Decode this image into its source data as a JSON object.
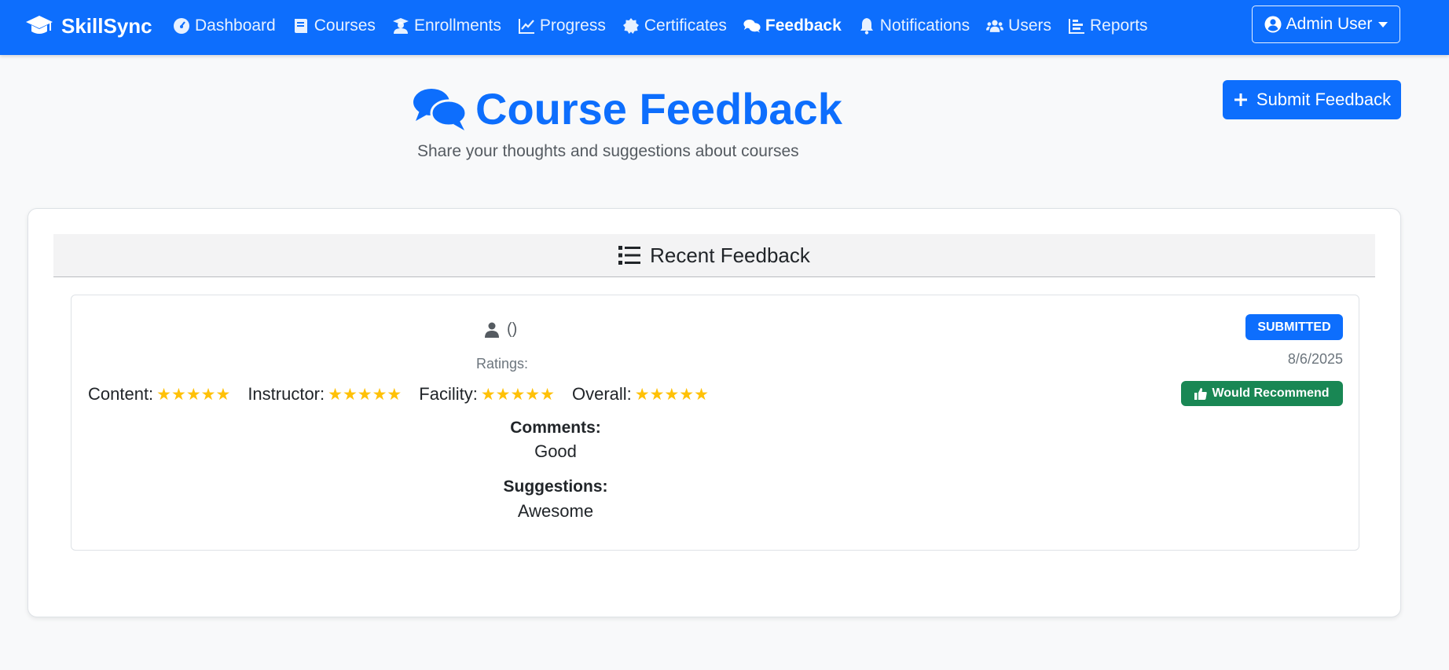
{
  "navbar": {
    "brand": "SkillSync",
    "links": [
      {
        "label": "Dashboard",
        "icon": "dashboard-icon",
        "active": false
      },
      {
        "label": "Courses",
        "icon": "book-icon",
        "active": false
      },
      {
        "label": "Enrollments",
        "icon": "user-graduate-icon",
        "active": false
      },
      {
        "label": "Progress",
        "icon": "chart-line-icon",
        "active": false
      },
      {
        "label": "Certificates",
        "icon": "certificate-icon",
        "active": false
      },
      {
        "label": "Feedback",
        "icon": "comments-icon",
        "active": true
      },
      {
        "label": "Notifications",
        "icon": "bell-icon",
        "active": false
      },
      {
        "label": "Users",
        "icon": "users-icon",
        "active": false
      },
      {
        "label": "Reports",
        "icon": "bar-chart-icon",
        "active": false
      }
    ],
    "user_menu": "Admin User"
  },
  "header": {
    "title": "Course Feedback",
    "subtitle": "Share your thoughts and suggestions about courses",
    "submit_label": "Submit Feedback"
  },
  "feedback_list": {
    "heading": "Recent Feedback",
    "items": [
      {
        "user": "()",
        "ratings_label": "Ratings:",
        "ratings": [
          {
            "label": "Content:",
            "stars": "★★★★★",
            "value": 5
          },
          {
            "label": "Instructor:",
            "stars": "★★★★★",
            "value": 5
          },
          {
            "label": "Facility:",
            "stars": "★★★★★",
            "value": 5
          },
          {
            "label": "Overall:",
            "stars": "★★★★★",
            "value": 5
          }
        ],
        "comments_label": "Comments:",
        "comments": "Good",
        "suggestions_label": "Suggestions:",
        "suggestions": "Awesome",
        "status": "SUBMITTED",
        "date": "8/6/2025",
        "recommend": "Would Recommend"
      }
    ]
  },
  "colors": {
    "primary": "#0d6efd",
    "success": "#198754",
    "star": "#ffc107"
  }
}
